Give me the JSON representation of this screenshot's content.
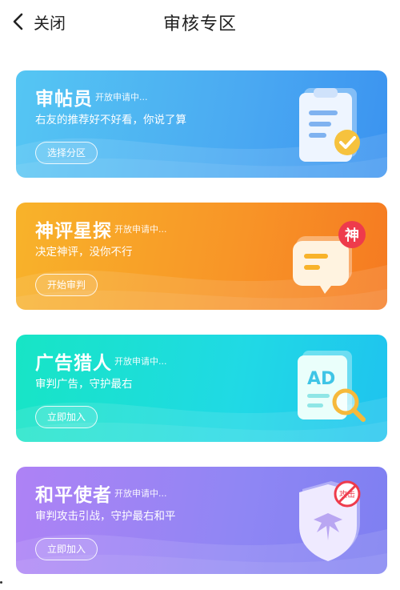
{
  "header": {
    "back_label": "关闭",
    "title": "审核专区"
  },
  "cards": [
    {
      "title": "审帖员",
      "status": "开放申请中...",
      "description": "右友的推荐好不好看，你说了算",
      "button": "选择分区",
      "icon": "clipboard-check-icon"
    },
    {
      "title": "神评星探",
      "status": "开放申请中...",
      "description": "决定神评，没你不行",
      "button": "开始审判",
      "icon": "speech-bubble-icon",
      "badge": "神"
    },
    {
      "title": "广告猎人",
      "status": "开放申请中...",
      "description": "审判广告，守护最右",
      "button": "立即加入",
      "icon": "ad-magnifier-icon",
      "ad_text": "AD"
    },
    {
      "title": "和平使者",
      "status": "开放申请中...",
      "description": "审判攻击引战，守护最右和平",
      "button": "立即加入",
      "icon": "peace-shield-icon",
      "stamp_text": "攻击"
    }
  ],
  "colors": {
    "card1": "#4aa9f2",
    "card2": "#f89427",
    "card3": "#20d9e5",
    "card4": "#8f86f4",
    "badge_red": "#ee3b4c",
    "check_yellow": "#f6c23e"
  }
}
